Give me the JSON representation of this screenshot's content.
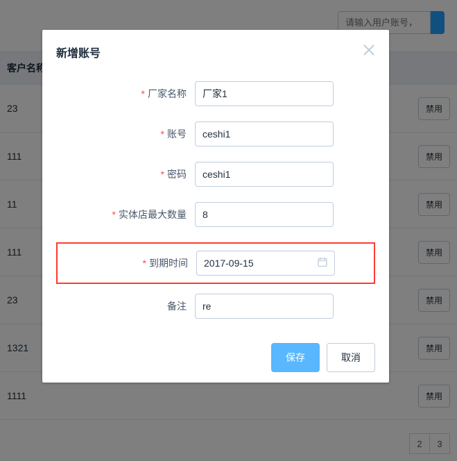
{
  "background": {
    "search_placeholder": "请输入用户账号，",
    "header": "客户名称",
    "rows": [
      "23",
      "111",
      "11",
      "111",
      "23",
      "1321",
      "1111"
    ],
    "action_label": "禁用",
    "pages": [
      "2",
      "3"
    ]
  },
  "modal": {
    "title": "新增账号",
    "fields": {
      "factory": {
        "label": "厂家名称",
        "value": "厂家1",
        "required": true
      },
      "account": {
        "label": "账号",
        "value": "ceshi1",
        "required": true
      },
      "password": {
        "label": "密码",
        "value": "ceshi1",
        "required": true
      },
      "max_stores": {
        "label": "实体店最大数量",
        "value": "8",
        "required": true
      },
      "expiry": {
        "label": "到期时间",
        "value": "2017-09-15",
        "required": true
      },
      "remark": {
        "label": "备注",
        "value": "re",
        "required": false
      }
    },
    "buttons": {
      "save": "保存",
      "cancel": "取消"
    }
  }
}
